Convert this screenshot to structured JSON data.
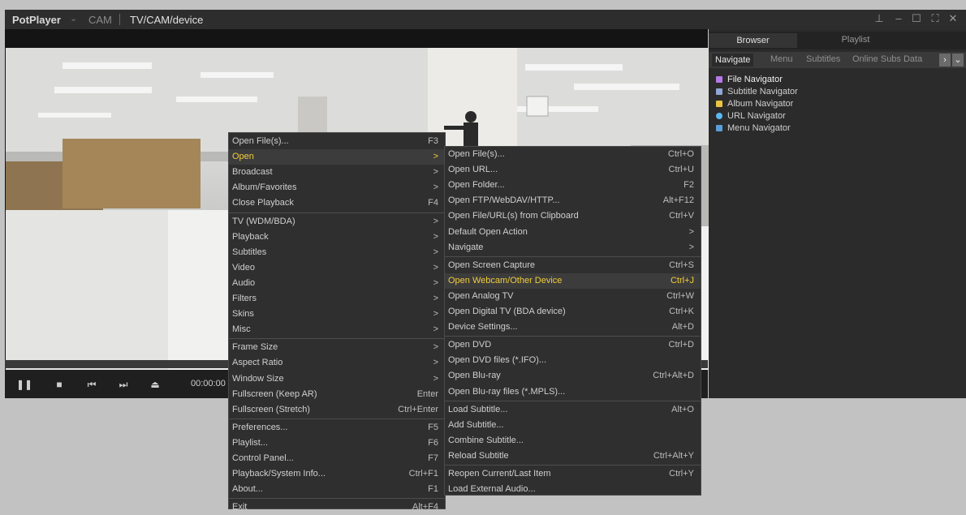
{
  "titlebar": {
    "app_name": "PotPlayer",
    "section": "CAM",
    "path": "TV/CAM/device"
  },
  "controls": {
    "time": "00:00:00"
  },
  "panel": {
    "tabs": [
      "Browser",
      "Playlist"
    ],
    "nav_tabs": [
      "Navigate",
      "Menu",
      "Subtitles",
      "Online Subs Data"
    ],
    "navigators": [
      {
        "label": "File Navigator",
        "icon": "file-navigator-icon",
        "color": "#b879e8"
      },
      {
        "label": "Subtitle Navigator",
        "icon": "subtitle-navigator-icon",
        "color": "#8fa6d6"
      },
      {
        "label": "Album Navigator",
        "icon": "album-navigator-icon",
        "color": "#e8c442"
      },
      {
        "label": "URL Navigator",
        "icon": "url-navigator-icon",
        "color": "#5cb8f2"
      },
      {
        "label": "Menu Navigator",
        "icon": "menu-navigator-icon",
        "color": "#5a9fd9"
      }
    ]
  },
  "main_menu": [
    {
      "label": "Open File(s)...",
      "shortcut": "F3"
    },
    {
      "label": "Open",
      "shortcut": ">"
    },
    {
      "label": "Broadcast",
      "shortcut": ">"
    },
    {
      "label": "Album/Favorites",
      "shortcut": ">"
    },
    {
      "label": "Close Playback",
      "shortcut": "F4"
    },
    {
      "label": "TV (WDM/BDA)",
      "shortcut": ">"
    },
    {
      "label": "Playback",
      "shortcut": ">"
    },
    {
      "label": "Subtitles",
      "shortcut": ">"
    },
    {
      "label": "Video",
      "shortcut": ">"
    },
    {
      "label": "Audio",
      "shortcut": ">"
    },
    {
      "label": "Filters",
      "shortcut": ">"
    },
    {
      "label": "Skins",
      "shortcut": ">"
    },
    {
      "label": "Misc",
      "shortcut": ">"
    },
    {
      "label": "Frame Size",
      "shortcut": ">"
    },
    {
      "label": "Aspect Ratio",
      "shortcut": ">"
    },
    {
      "label": "Window Size",
      "shortcut": ">"
    },
    {
      "label": "Fullscreen (Keep AR)",
      "shortcut": "Enter"
    },
    {
      "label": "Fullscreen (Stretch)",
      "shortcut": "Ctrl+Enter"
    },
    {
      "label": "Preferences...",
      "shortcut": "F5"
    },
    {
      "label": "Playlist...",
      "shortcut": "F6"
    },
    {
      "label": "Control Panel...",
      "shortcut": "F7"
    },
    {
      "label": "Playback/System Info...",
      "shortcut": "Ctrl+F1"
    },
    {
      "label": "About...",
      "shortcut": "F1"
    },
    {
      "label": "Exit",
      "shortcut": "Alt+F4"
    }
  ],
  "open_submenu": [
    {
      "label": "Open File(s)...",
      "shortcut": "Ctrl+O"
    },
    {
      "label": "Open URL...",
      "shortcut": "Ctrl+U"
    },
    {
      "label": "Open Folder...",
      "shortcut": "F2"
    },
    {
      "label": "Open FTP/WebDAV/HTTP...",
      "shortcut": "Alt+F12"
    },
    {
      "label": "Open File/URL(s) from Clipboard",
      "shortcut": "Ctrl+V"
    },
    {
      "label": "Default Open Action",
      "shortcut": ">"
    },
    {
      "label": "Navigate",
      "shortcut": ">"
    },
    {
      "label": "Open Screen Capture",
      "shortcut": "Ctrl+S"
    },
    {
      "label": "Open Webcam/Other Device",
      "shortcut": "Ctrl+J"
    },
    {
      "label": "Open Analog TV",
      "shortcut": "Ctrl+W"
    },
    {
      "label": "Open Digital TV (BDA device)",
      "shortcut": "Ctrl+K"
    },
    {
      "label": "Device Settings...",
      "shortcut": "Alt+D"
    },
    {
      "label": "Open DVD",
      "shortcut": "Ctrl+D"
    },
    {
      "label": "Open DVD files (*.IFO)...",
      "shortcut": ""
    },
    {
      "label": "Open Blu-ray",
      "shortcut": "Ctrl+Alt+D"
    },
    {
      "label": "Open Blu-ray files (*.MPLS)...",
      "shortcut": ""
    },
    {
      "label": "Load Subtitle...",
      "shortcut": "Alt+O"
    },
    {
      "label": "Add Subtitle...",
      "shortcut": ""
    },
    {
      "label": "Combine Subtitle...",
      "shortcut": ""
    },
    {
      "label": "Reload Subtitle",
      "shortcut": "Ctrl+Alt+Y"
    },
    {
      "label": "Reopen Current/Last Item",
      "shortcut": "Ctrl+Y"
    },
    {
      "label": "Load External Audio...",
      "shortcut": ""
    }
  ],
  "colors": {
    "highlight_text": "#f2cd3b",
    "menu_bg": "#2f2f2f"
  }
}
